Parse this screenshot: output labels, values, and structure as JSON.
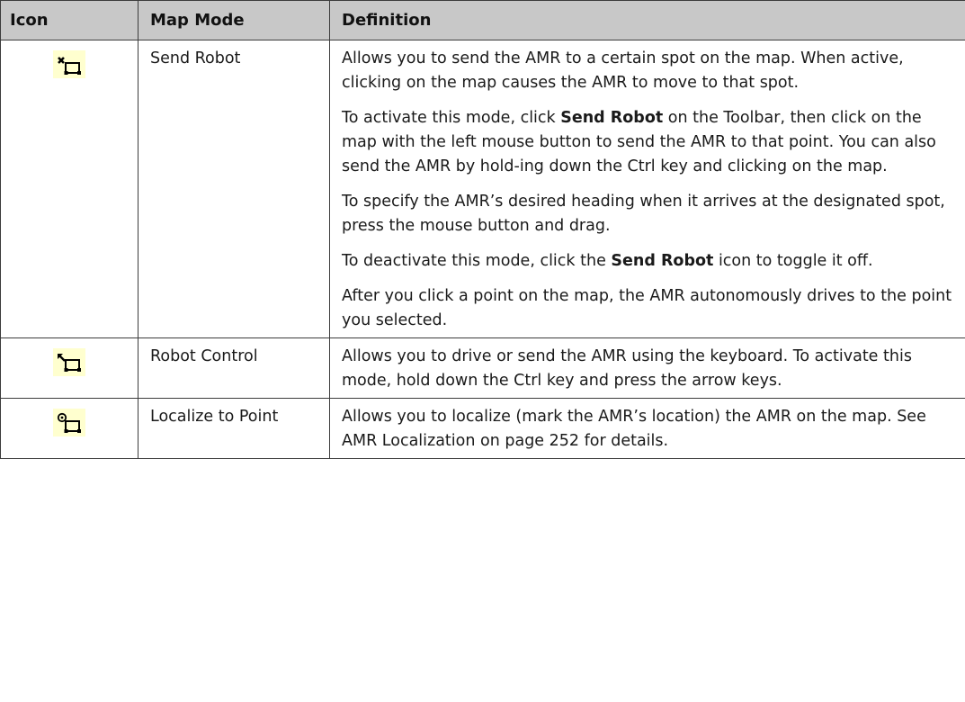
{
  "header": {
    "icon": "Icon",
    "map_mode": "Map Mode",
    "definition": "Definition"
  },
  "rows": [
    {
      "icon": "send-robot-icon",
      "mode": "Send Robot",
      "definition": [
        {
          "text": "Allows you to send the AMR to a certain spot on the map. When active, clicking on the map causes the AMR to move to that spot."
        },
        {
          "pre": "To activate this mode, click ",
          "bold": "Send Robot",
          "post": " on the Toolbar, then click on the map with the left mouse button to send the AMR to that point. You can also send the AMR by hold-ing down the Ctrl key and clicking on the map."
        },
        {
          "text": "To specify the AMR’s desired heading when it arrives at the designated spot, press the mouse button and drag."
        },
        {
          "pre": "To deactivate this mode, click the ",
          "bold": "Send Robot",
          "post": " icon to toggle it off."
        },
        {
          "text": "After you click a point on the map, the AMR autonomously drives to the point you selected."
        }
      ]
    },
    {
      "icon": "robot-control-icon",
      "mode": "Robot Control",
      "definition": [
        {
          "text": "Allows you to drive or send the AMR using the keyboard. To activate this mode, hold down the Ctrl key and press the arrow keys."
        }
      ]
    },
    {
      "icon": "localize-to-point-icon",
      "mode": "Localize to Point",
      "definition": [
        {
          "text": "Allows you to localize (mark the AMR’s location) the AMR on the map. See AMR Localization on page 252 for details."
        }
      ]
    }
  ]
}
